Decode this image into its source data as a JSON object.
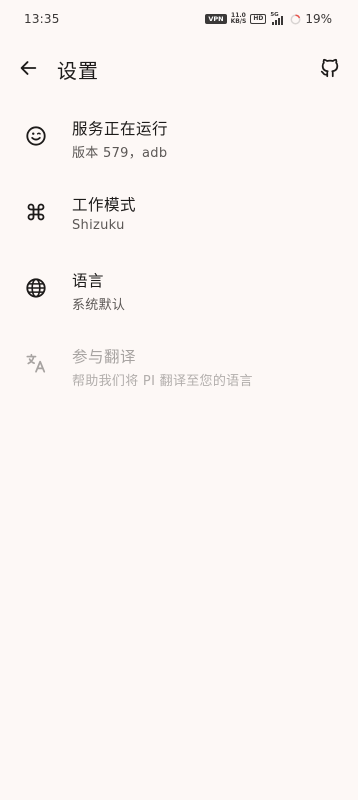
{
  "status_bar": {
    "time": "13:35",
    "vpn": "VPN",
    "net_speed_value": "11.0",
    "net_speed_unit": "KB/S",
    "hd": "HD",
    "network": "5G",
    "battery_percent": "19%",
    "battery_level": 0.19
  },
  "app_bar": {
    "title": "设置",
    "back_icon": "arrow-back-icon",
    "github_icon": "github-icon"
  },
  "settings": [
    {
      "icon": "smiley-icon",
      "title": "服务正在运行",
      "subtitle": "版本 579，adb",
      "enabled": true
    },
    {
      "icon": "command-icon",
      "title": "工作模式",
      "subtitle": "Shizuku",
      "enabled": true
    },
    {
      "icon": "globe-icon",
      "title": "语言",
      "subtitle": "系统默认",
      "enabled": true
    },
    {
      "icon": "translate-icon",
      "title": "参与翻译",
      "subtitle": "帮助我们将 PI 翻译至您的语言",
      "enabled": false
    }
  ],
  "colors": {
    "background": "#fdf8f6",
    "text_primary": "#1d1b1a",
    "text_secondary": "#5c5856",
    "text_disabled": "#a7a3a1",
    "battery_ring": "#e8524a"
  }
}
